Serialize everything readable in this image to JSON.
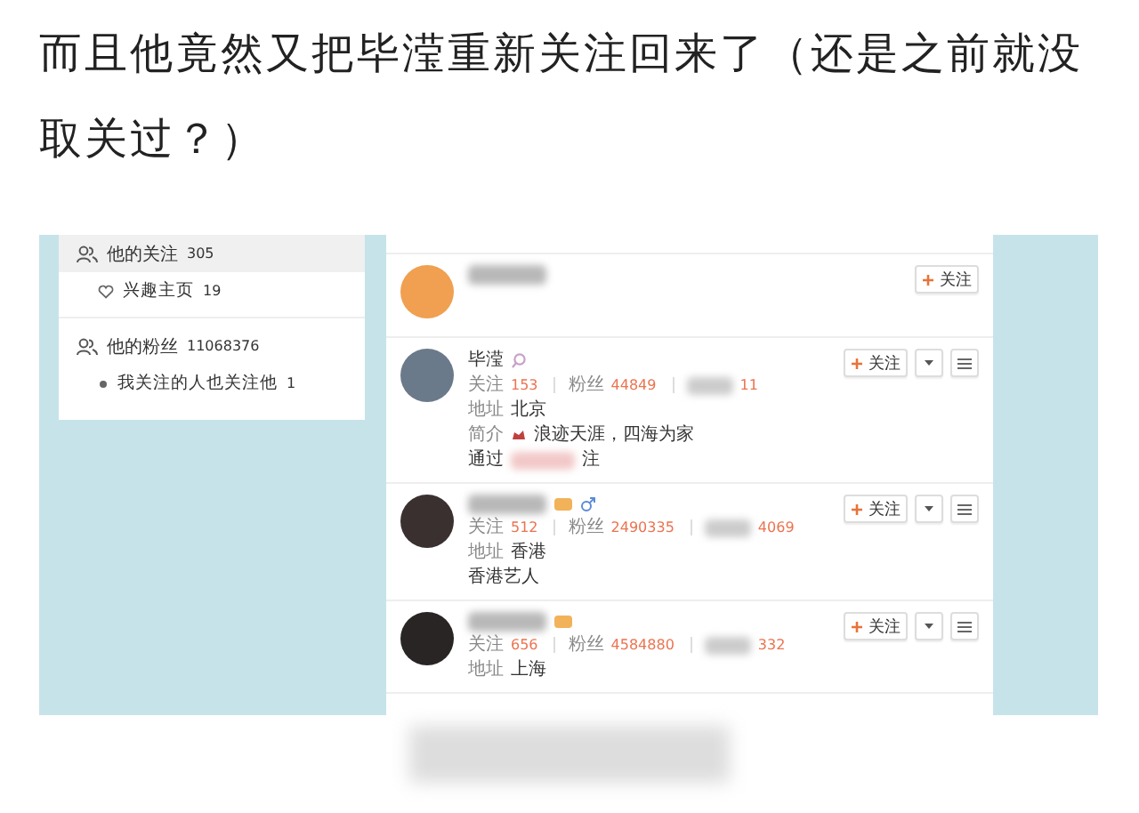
{
  "post": {
    "text": "而且他竟然又把毕滢重新关注回来了（还是之前就没取关过？）"
  },
  "sidebar": {
    "items": [
      {
        "kind": "group",
        "label": "他的关注",
        "count": "305",
        "selected": true
      },
      {
        "kind": "interest",
        "label": "兴趣主页",
        "count": "19",
        "selected": false
      },
      {
        "kind": "group",
        "label": "他的粉丝",
        "count": "11068376",
        "selected": false
      },
      {
        "kind": "common",
        "label": "我关注的人也关注他",
        "count": "1",
        "selected": false
      }
    ]
  },
  "users": [
    {
      "color": "#f0a050",
      "name_hidden": true,
      "follow": "关注",
      "more": false
    },
    {
      "color": "#6a7a8a",
      "name": "毕滢",
      "badges": [
        {
          "kind": "search"
        }
      ],
      "follow": "关注",
      "more": true,
      "follows_label": "关注",
      "follows": "153",
      "fans_label": "粉丝",
      "fans": "44849",
      "third": "11",
      "address_label": "地址",
      "address": "北京",
      "intro_label": "简介",
      "intro": "浪迹天涯，四海为家",
      "intro_icon": true,
      "via": [
        "通过",
        "注"
      ]
    },
    {
      "color": "#3a3030",
      "name_hidden": true,
      "badges": [
        {
          "kind": "badge"
        },
        {
          "kind": "male"
        }
      ],
      "follow": "关注",
      "more": true,
      "follows_label": "关注",
      "follows": "512",
      "fans_label": "粉丝",
      "fans": "2490335",
      "third": "4069",
      "address_label": "地址",
      "address": "香港",
      "bio": "香港艺人"
    },
    {
      "color": "#2a2525",
      "name_hidden": true,
      "badges": [
        {
          "kind": "badge"
        }
      ],
      "follow": "关注",
      "more": true,
      "follows_label": "关注",
      "follows": "656",
      "fans_label": "粉丝",
      "fans": "4584880",
      "third": "332",
      "address_label": "地址",
      "address": "上海"
    }
  ]
}
